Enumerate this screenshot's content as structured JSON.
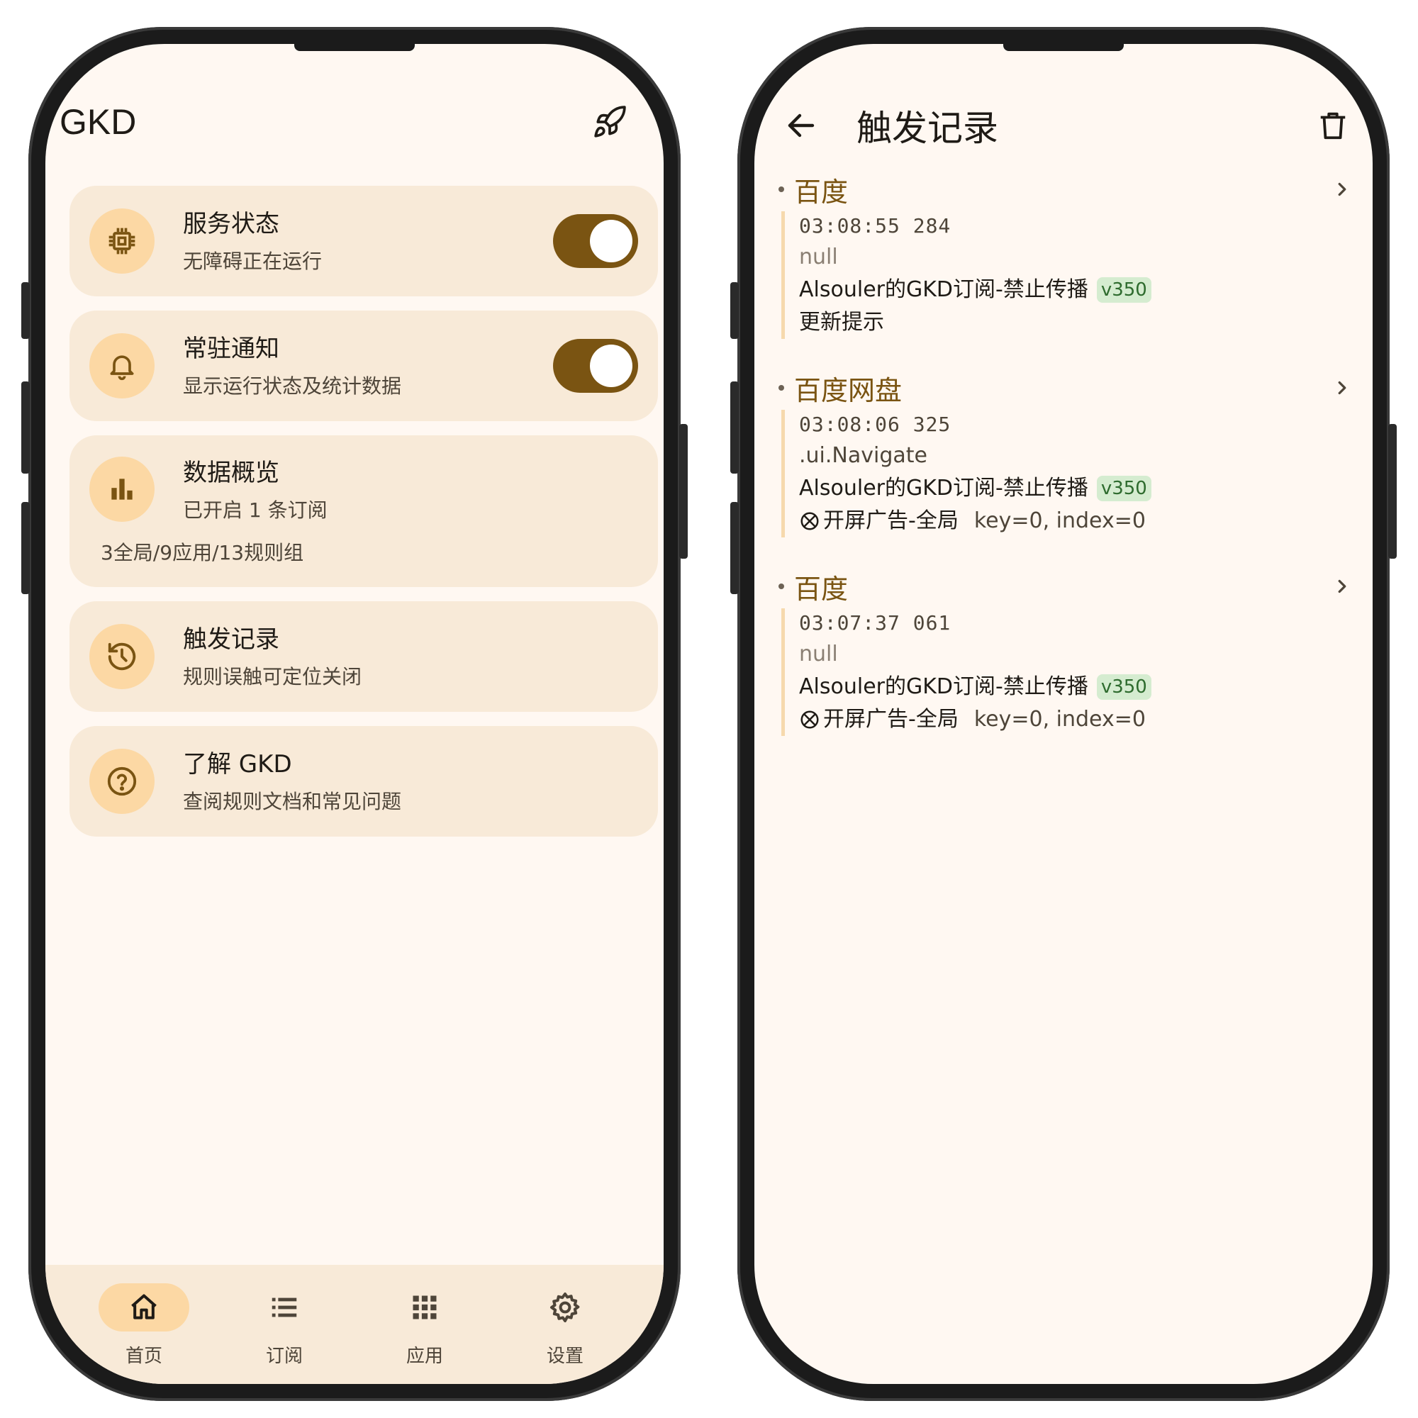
{
  "home": {
    "app_title": "GKD",
    "cards": [
      {
        "title": "服务状态",
        "subtitle": "无障碍正在运行",
        "icon": "chip-icon",
        "switch_on": true
      },
      {
        "title": "常驻通知",
        "subtitle": "显示运行状态及统计数据",
        "icon": "bell-icon",
        "switch_on": true
      },
      {
        "title": "数据概览",
        "subtitle": "已开启 1 条订阅",
        "extra": "3全局/9应用/13规则组",
        "icon": "bar-chart-icon"
      },
      {
        "title": "触发记录",
        "subtitle": "规则误触可定位关闭",
        "icon": "history-icon"
      },
      {
        "title": "了解 GKD",
        "subtitle": "查阅规则文档和常见问题",
        "icon": "help-circle-icon"
      }
    ],
    "nav": [
      {
        "label": "首页",
        "icon": "home-icon",
        "active": true
      },
      {
        "label": "订阅",
        "icon": "list-icon"
      },
      {
        "label": "应用",
        "icon": "grid-icon"
      },
      {
        "label": "设置",
        "icon": "gear-icon"
      }
    ],
    "colors": {
      "primary": "#7a5412",
      "card": "#f8ead8",
      "icon_bg": "#fcd8a4",
      "background": "#fff8f2"
    }
  },
  "records_page": {
    "title": "触发记录",
    "records": [
      {
        "app": "百度",
        "time": "03:08:55 284",
        "activity": "null",
        "subscription": "Alsouler的GKD订阅-禁止传播",
        "version": "v350",
        "rule": "更新提示",
        "key": ""
      },
      {
        "app": "百度网盘",
        "time": "03:08:06 325",
        "activity": ".ui.Navigate",
        "subscription": "Alsouler的GKD订阅-禁止传播",
        "version": "v350",
        "rule": "开屏广告-全局",
        "key": "key=0, index=0"
      },
      {
        "app": "百度",
        "time": "03:07:37 061",
        "activity": "null",
        "subscription": "Alsouler的GKD订阅-禁止传播",
        "version": "v350",
        "rule": "开屏广告-全局",
        "key": "key=0, index=0"
      }
    ]
  }
}
